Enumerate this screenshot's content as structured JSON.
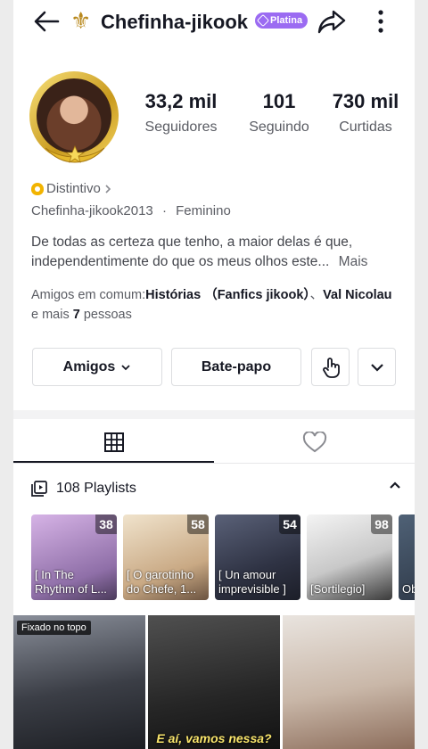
{
  "header": {
    "username": "Chefinha-jikook",
    "tier_badge": "Platina",
    "icons": {
      "back": "back-arrow-icon",
      "title_emblem": "fleur-de-lis-icon",
      "share": "share-icon",
      "more": "more-vertical-icon"
    }
  },
  "stats": [
    {
      "value": "33,2 mil",
      "label": "Seguidores"
    },
    {
      "value": "101",
      "label": "Seguindo"
    },
    {
      "value": "730 mil",
      "label": "Curtidas"
    }
  ],
  "profile": {
    "badge_label": "Distintivo",
    "handle": "Chefinha-jikook2013",
    "separator": "·",
    "gender": "Feminino",
    "bio": "De todas as certeza que tenho, a maior delas é que, independentimente do que os meus olhos este...",
    "bio_more": "Mais"
  },
  "mutual": {
    "prefix": "Amigos em comum:",
    "name1": "Histórias （Fanfics jikook）",
    "sep": "、",
    "name2": "Val Nicolau",
    "middle": " e mais ",
    "count": "7",
    "suffix": " pessoas"
  },
  "actions": {
    "friends": "Amigos",
    "chat": "Bate-papo",
    "icons": {
      "friends_dropdown": "chevron-down-icon",
      "poke": "hand-pointer-icon",
      "expand": "chevron-down-icon"
    }
  },
  "tabs": {
    "videos": "grid-icon",
    "liked": "heart-icon"
  },
  "playlists": {
    "header": "108 Playlists",
    "items": [
      {
        "count": "38",
        "title": "[ In The Rhythm of L..."
      },
      {
        "count": "58",
        "title": "[ O garotinho do Chefe, 1..."
      },
      {
        "count": "54",
        "title": "[ Un amour imprevisible ]"
      },
      {
        "count": "98",
        "title": "[Sortilegio]"
      },
      {
        "count": "",
        "title": "Ob po"
      }
    ],
    "colors": [
      "#c7a1d9",
      "#e0cdb0",
      "#3a3f52",
      "#e6e6e6",
      "#3d4b5c"
    ]
  },
  "videos": [
    {
      "pinned": "Fixado no topo",
      "caption": ""
    },
    {
      "pinned": "",
      "caption": "E aí, vamos nessa?"
    },
    {
      "pinned": "",
      "caption": ""
    }
  ]
}
